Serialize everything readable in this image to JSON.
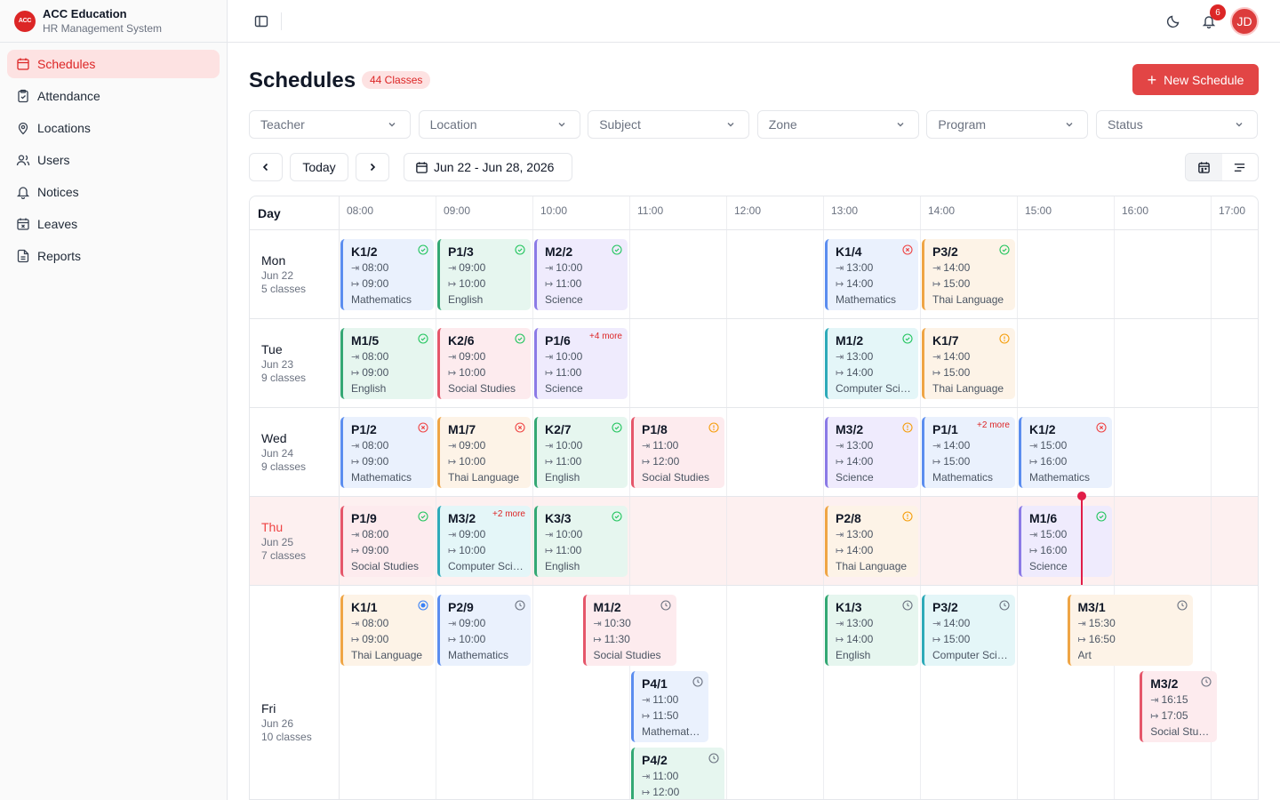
{
  "brand": {
    "logo": "ACC",
    "name": "ACC Education",
    "subtitle": "HR Management System"
  },
  "nav": [
    {
      "label": "Schedules",
      "icon": "calendar-icon",
      "active": true
    },
    {
      "label": "Attendance",
      "icon": "clipboard-icon"
    },
    {
      "label": "Locations",
      "icon": "map-pin-icon"
    },
    {
      "label": "Users",
      "icon": "users-icon"
    },
    {
      "label": "Notices",
      "icon": "bell-icon"
    },
    {
      "label": "Leaves",
      "icon": "calendar-x-icon"
    },
    {
      "label": "Reports",
      "icon": "file-text-icon"
    }
  ],
  "topbar": {
    "notification_count": "6",
    "avatar": "JD"
  },
  "page": {
    "title": "Schedules",
    "count": "44 Classes",
    "new_button": "New Schedule"
  },
  "filters": [
    "Teacher",
    "Location",
    "Subject",
    "Zone",
    "Program",
    "Status"
  ],
  "toolbar": {
    "today": "Today",
    "date_range": "Jun 22 - Jun 28, 2026"
  },
  "grid": {
    "day_header": "Day",
    "times": [
      "08:00",
      "09:00",
      "10:00",
      "11:00",
      "12:00",
      "13:00",
      "14:00",
      "15:00",
      "16:00",
      "17:00"
    ],
    "days": [
      {
        "name": "Mon",
        "date": "Jun 22",
        "count": "5 classes"
      },
      {
        "name": "Tue",
        "date": "Jun 23",
        "count": "9 classes"
      },
      {
        "name": "Wed",
        "date": "Jun 24",
        "count": "9 classes"
      },
      {
        "name": "Thu",
        "date": "Jun 25",
        "count": "7 classes",
        "today": true
      },
      {
        "name": "Fri",
        "date": "Jun 26",
        "count": "10 classes"
      }
    ]
  },
  "colors": {
    "accent": "#dc2626",
    "now_line": "#e11d48"
  },
  "cards": [
    {
      "day": 0,
      "lane": 0,
      "start": "08:00",
      "end": "09:00",
      "code": "K1/2",
      "subject": "Mathematics",
      "color": "blue",
      "status": "done"
    },
    {
      "day": 0,
      "lane": 0,
      "start": "09:00",
      "end": "10:00",
      "code": "P1/3",
      "subject": "English",
      "color": "green",
      "status": "done"
    },
    {
      "day": 0,
      "lane": 0,
      "start": "10:00",
      "end": "11:00",
      "code": "M2/2",
      "subject": "Science",
      "color": "purple",
      "status": "done"
    },
    {
      "day": 0,
      "lane": 0,
      "start": "13:00",
      "end": "14:00",
      "code": "K1/4",
      "subject": "Mathematics",
      "color": "blue",
      "status": "cancelled"
    },
    {
      "day": 0,
      "lane": 0,
      "start": "14:00",
      "end": "15:00",
      "code": "P3/2",
      "subject": "Thai Language",
      "color": "orange",
      "status": "done"
    },
    {
      "day": 1,
      "lane": 0,
      "start": "08:00",
      "end": "09:00",
      "code": "M1/5",
      "subject": "English",
      "color": "green",
      "status": "done"
    },
    {
      "day": 1,
      "lane": 0,
      "start": "09:00",
      "end": "10:00",
      "code": "K2/6",
      "subject": "Social Studies",
      "color": "red",
      "status": "done"
    },
    {
      "day": 1,
      "lane": 0,
      "start": "10:00",
      "end": "11:00",
      "code": "P1/6",
      "subject": "Science",
      "color": "purple",
      "more": "+4 more"
    },
    {
      "day": 1,
      "lane": 0,
      "start": "13:00",
      "end": "14:00",
      "code": "M1/2",
      "subject": "Computer Science",
      "color": "teal",
      "status": "done"
    },
    {
      "day": 1,
      "lane": 0,
      "start": "14:00",
      "end": "15:00",
      "code": "K1/7",
      "subject": "Thai Language",
      "color": "orange",
      "status": "warning"
    },
    {
      "day": 2,
      "lane": 0,
      "start": "08:00",
      "end": "09:00",
      "code": "P1/2",
      "subject": "Mathematics",
      "color": "blue",
      "status": "cancelled"
    },
    {
      "day": 2,
      "lane": 0,
      "start": "09:00",
      "end": "10:00",
      "code": "M1/7",
      "subject": "Thai Language",
      "color": "orange",
      "status": "cancelled"
    },
    {
      "day": 2,
      "lane": 0,
      "start": "10:00",
      "end": "11:00",
      "code": "K2/7",
      "subject": "English",
      "color": "green",
      "status": "done"
    },
    {
      "day": 2,
      "lane": 0,
      "start": "11:00",
      "end": "12:00",
      "code": "P1/8",
      "subject": "Social Studies",
      "color": "red",
      "status": "warning"
    },
    {
      "day": 2,
      "lane": 0,
      "start": "13:00",
      "end": "14:00",
      "code": "M3/2",
      "subject": "Science",
      "color": "purple",
      "status": "warning"
    },
    {
      "day": 2,
      "lane": 0,
      "start": "14:00",
      "end": "15:00",
      "code": "P1/1",
      "subject": "Mathematics",
      "color": "blue",
      "more": "+2 more"
    },
    {
      "day": 2,
      "lane": 0,
      "start": "15:00",
      "end": "16:00",
      "code": "K1/2",
      "subject": "Mathematics",
      "color": "blue",
      "status": "cancelled"
    },
    {
      "day": 3,
      "lane": 0,
      "start": "08:00",
      "end": "09:00",
      "code": "P1/9",
      "subject": "Social Studies",
      "color": "red",
      "status": "done"
    },
    {
      "day": 3,
      "lane": 0,
      "start": "09:00",
      "end": "10:00",
      "code": "M3/2",
      "subject": "Computer Science",
      "color": "teal",
      "more": "+2 more"
    },
    {
      "day": 3,
      "lane": 0,
      "start": "10:00",
      "end": "11:00",
      "code": "K3/3",
      "subject": "English",
      "color": "green",
      "status": "done"
    },
    {
      "day": 3,
      "lane": 0,
      "start": "13:00",
      "end": "14:00",
      "code": "P2/8",
      "subject": "Thai Language",
      "color": "orange",
      "status": "warning"
    },
    {
      "day": 3,
      "lane": 0,
      "start": "15:00",
      "end": "16:00",
      "code": "M1/6",
      "subject": "Science",
      "color": "purple",
      "status": "done"
    },
    {
      "day": 4,
      "lane": 0,
      "start": "08:00",
      "end": "09:00",
      "code": "K1/1",
      "subject": "Thai Language",
      "color": "orange",
      "status": "live"
    },
    {
      "day": 4,
      "lane": 0,
      "start": "09:00",
      "end": "10:00",
      "code": "P2/9",
      "subject": "Mathematics",
      "color": "blue",
      "status": "scheduled"
    },
    {
      "day": 4,
      "lane": 0,
      "start": "10:30",
      "end": "11:30",
      "code": "M1/2",
      "subject": "Social Studies",
      "color": "red",
      "status": "scheduled"
    },
    {
      "day": 4,
      "lane": 0,
      "start": "13:00",
      "end": "14:00",
      "code": "K1/3",
      "subject": "English",
      "color": "green",
      "status": "scheduled"
    },
    {
      "day": 4,
      "lane": 0,
      "start": "14:00",
      "end": "15:00",
      "code": "P3/2",
      "subject": "Computer Science",
      "color": "teal",
      "status": "scheduled"
    },
    {
      "day": 4,
      "lane": 0,
      "start": "15:30",
      "end": "16:50",
      "code": "M3/1",
      "subject": "Art",
      "color": "orange",
      "status": "scheduled"
    },
    {
      "day": 4,
      "lane": 1,
      "start": "11:00",
      "end": "11:50",
      "code": "P4/1",
      "subject": "Mathematics",
      "color": "blue",
      "status": "scheduled"
    },
    {
      "day": 4,
      "lane": 1,
      "start": "16:15",
      "end": "17:05",
      "code": "M3/2",
      "subject": "Social Studies",
      "color": "red",
      "status": "scheduled"
    },
    {
      "day": 4,
      "lane": 2,
      "start": "11:00",
      "end": "12:00",
      "code": "P4/2",
      "subject": "",
      "color": "green",
      "status": "scheduled"
    }
  ]
}
